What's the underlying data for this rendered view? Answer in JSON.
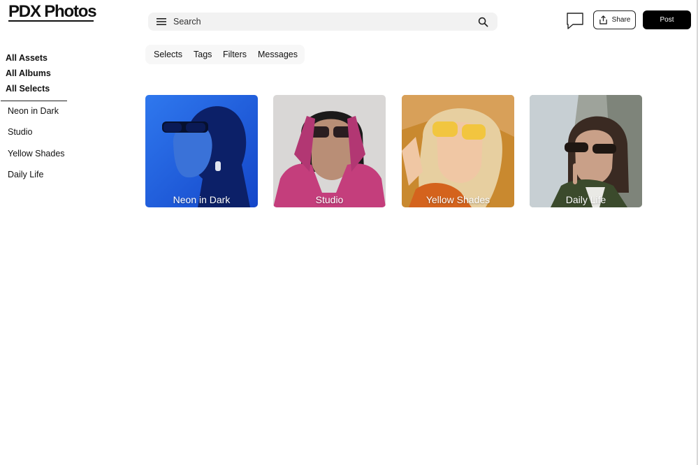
{
  "app": {
    "logo": "PDX Photos"
  },
  "sidebar": {
    "links": [
      {
        "label": "All Assets"
      },
      {
        "label": "All Albums"
      },
      {
        "label": "All Selects"
      }
    ],
    "albums": [
      {
        "label": "Neon in Dark"
      },
      {
        "label": "Studio"
      },
      {
        "label": "Yellow Shades"
      },
      {
        "label": "Daily Life"
      }
    ]
  },
  "search": {
    "placeholder": "Search",
    "value": "",
    "menu_icon": "menu-icon",
    "search_icon": "search-icon"
  },
  "header": {
    "chat_icon": "chat-bubble-icon",
    "share_label": "Share",
    "share_icon": "share-icon",
    "post_label": "Post"
  },
  "filters": {
    "tabs": [
      {
        "label": "Selects"
      },
      {
        "label": "Tags"
      },
      {
        "label": "Filters"
      },
      {
        "label": "Messages"
      }
    ]
  },
  "gallery": {
    "albums": [
      {
        "title": "Neon in Dark",
        "color": "#1f63e8"
      },
      {
        "title": "Studio",
        "color": "#d8d6d6"
      },
      {
        "title": "Yellow Shades",
        "color": "#cf7d2a"
      },
      {
        "title": "Daily Life",
        "color": "#8d8f82"
      }
    ]
  }
}
